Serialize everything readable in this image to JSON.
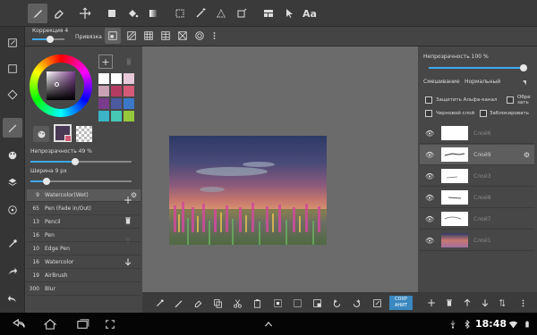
{
  "toolbar": {
    "tools": [
      "brush-tool",
      "eraser-tool",
      "move-tool",
      "fill-rect-tool",
      "bucket-tool",
      "gradient-tool",
      "select-tool",
      "magic-wand-tool",
      "lasso-tool",
      "transform-tool",
      "layout-tool",
      "pointer-tool",
      "text-tool"
    ],
    "text_tool_label": "Aa"
  },
  "subbar": {
    "correction_label": "Коррекция 4",
    "snap_label": "Привязка"
  },
  "brush": {
    "opacity_label": "Непрозрачность 49 %",
    "opacity_value": 49,
    "width_label": "Ширина 9 px",
    "width_value": 9,
    "items": [
      {
        "size": "9",
        "name": "Watercolor(Wet)"
      },
      {
        "size": "65",
        "name": "Pen (Fade in/Out)"
      },
      {
        "size": "13",
        "name": "Pencil"
      },
      {
        "size": "16",
        "name": "Pen"
      },
      {
        "size": "10",
        "name": "Edge Pen"
      },
      {
        "size": "16",
        "name": "Watercolor"
      },
      {
        "size": "19",
        "name": "AirBrush"
      },
      {
        "size": "300",
        "name": "Blur"
      }
    ],
    "add_symbol": "+"
  },
  "palette": {
    "colors": [
      "#ffffff",
      "#ffffff",
      "#e6e6e6",
      "#c9a0b4",
      "#b43c63",
      "#d45a78",
      "#f0c8d2",
      "#7a3c8c",
      "#4b5aa0",
      "#3c78c8",
      "#5aa0c8",
      "#3cb4c8",
      "#46c8b4",
      "#3ca03c",
      "#96c83c"
    ],
    "current_color": "#4a3a55"
  },
  "layers": {
    "opacity_label": "Непрозрачность 100 %",
    "opacity_value": 100,
    "blend_label": "Смешивание",
    "blend_value": "Нормальный",
    "alpha_lock": "Защитить Альфа-канал",
    "clip": "Обре зать",
    "draft": "Черновой слой",
    "lock": "Заблокировать",
    "items": [
      {
        "name": "Слой6",
        "visible": true,
        "selected": false
      },
      {
        "name": "Слой9",
        "visible": true,
        "selected": true
      },
      {
        "name": "Слой3",
        "visible": true,
        "selected": false
      },
      {
        "name": "Слой8",
        "visible": true,
        "selected": false
      },
      {
        "name": "Слой7",
        "visible": true,
        "selected": false
      },
      {
        "name": "Слой1",
        "visible": true,
        "selected": false
      }
    ]
  },
  "bottom": {
    "save_label": "СОХР АНИТ"
  },
  "status": {
    "time": "18:48"
  }
}
